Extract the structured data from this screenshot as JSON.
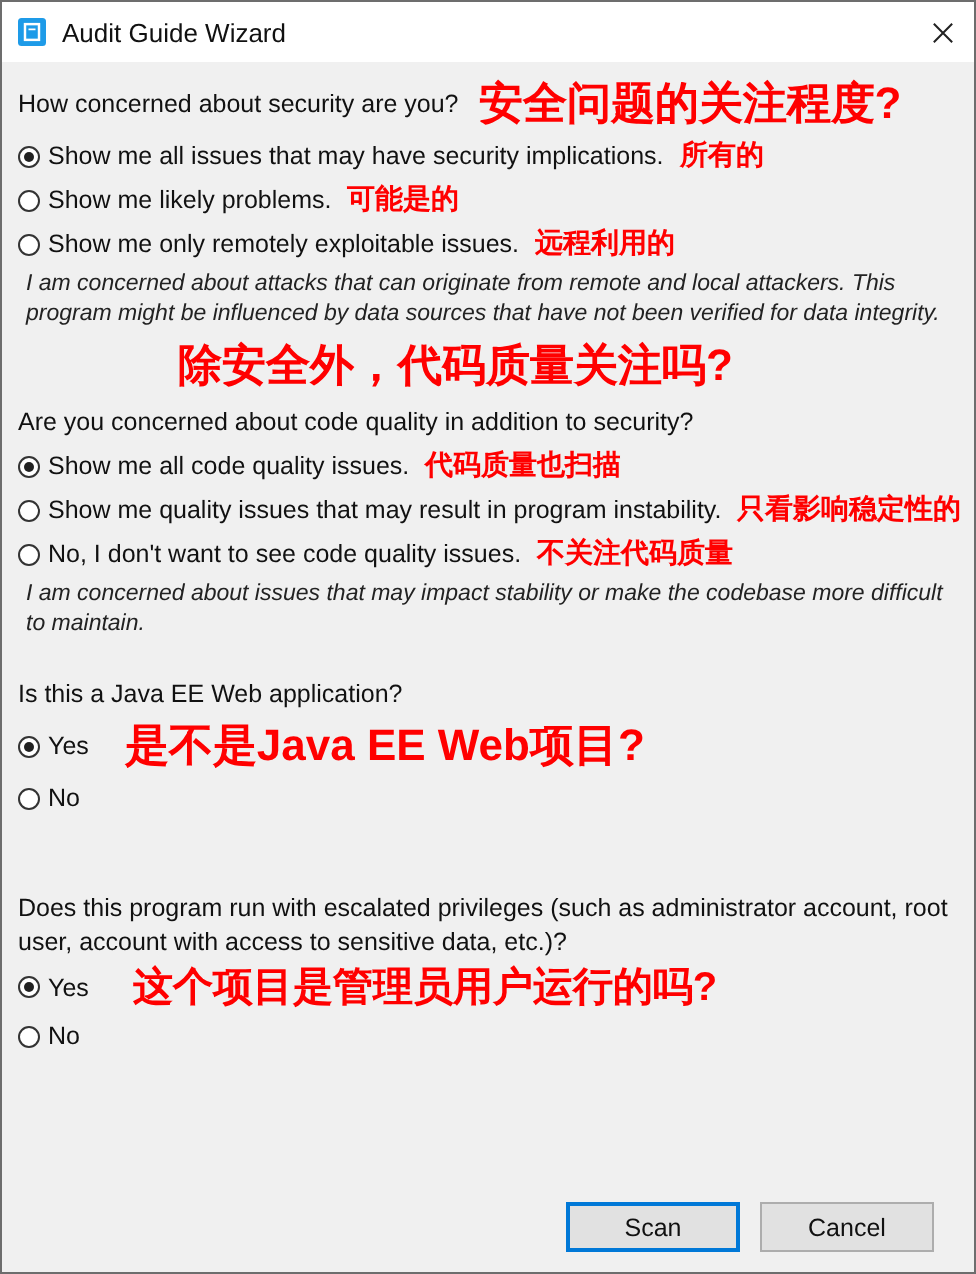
{
  "window": {
    "title": "Audit Guide Wizard"
  },
  "sections": [
    {
      "question": "How concerned about security are you?",
      "annotation": {
        "text": "安全问题的关注程度?",
        "kind": "title"
      },
      "options": [
        {
          "label": "Show me all issues that may have security implications.",
          "selected": true,
          "annotation": {
            "text": "所有的",
            "kind": "note"
          }
        },
        {
          "label": "Show me likely problems.",
          "selected": false,
          "annotation": {
            "text": "可能是的",
            "kind": "note"
          }
        },
        {
          "label": "Show me only remotely exploitable issues.",
          "selected": false,
          "annotation": {
            "text": "远程利用的",
            "kind": "note"
          }
        }
      ],
      "description": "I am concerned about attacks that can originate from remote and local attackers. This program might be influenced by data sources that have not been verified for data integrity."
    },
    {
      "question": "Are you concerned about code quality in addition to security?",
      "annotation": {
        "text": "除安全外，代码质量关注吗?",
        "kind": "banner"
      },
      "options": [
        {
          "label": "Show me all code quality issues.",
          "selected": true,
          "annotation": {
            "text": "代码质量也扫描",
            "kind": "note"
          }
        },
        {
          "label": "Show me quality issues that may result in program instability.",
          "selected": false,
          "annotation": {
            "text": "只看影响稳定性的",
            "kind": "note"
          }
        },
        {
          "label": "No, I don't want to see code quality issues.",
          "selected": false,
          "annotation": {
            "text": "不关注代码质量",
            "kind": "note"
          }
        }
      ],
      "description": "I am concerned about issues that may impact stability or make the codebase more difficult to maintain."
    },
    {
      "question": "Is this a Java EE Web application?",
      "options": [
        {
          "label": "Yes",
          "selected": true,
          "annotation": {
            "text": "是不是Java EE Web项目?",
            "kind": "title"
          }
        },
        {
          "label": "No",
          "selected": false
        }
      ]
    },
    {
      "question": "Does this program run with escalated privileges (such as administrator account, root user, account with access to sensitive data, etc.)?",
      "options": [
        {
          "label": "Yes",
          "selected": true,
          "annotation": {
            "text": "这个项目是管理员用户运行的吗?",
            "kind": "title"
          }
        },
        {
          "label": "No",
          "selected": false
        }
      ]
    }
  ],
  "buttons": [
    {
      "label": "Scan",
      "kind": "default"
    },
    {
      "label": "Cancel",
      "kind": "normal"
    }
  ]
}
